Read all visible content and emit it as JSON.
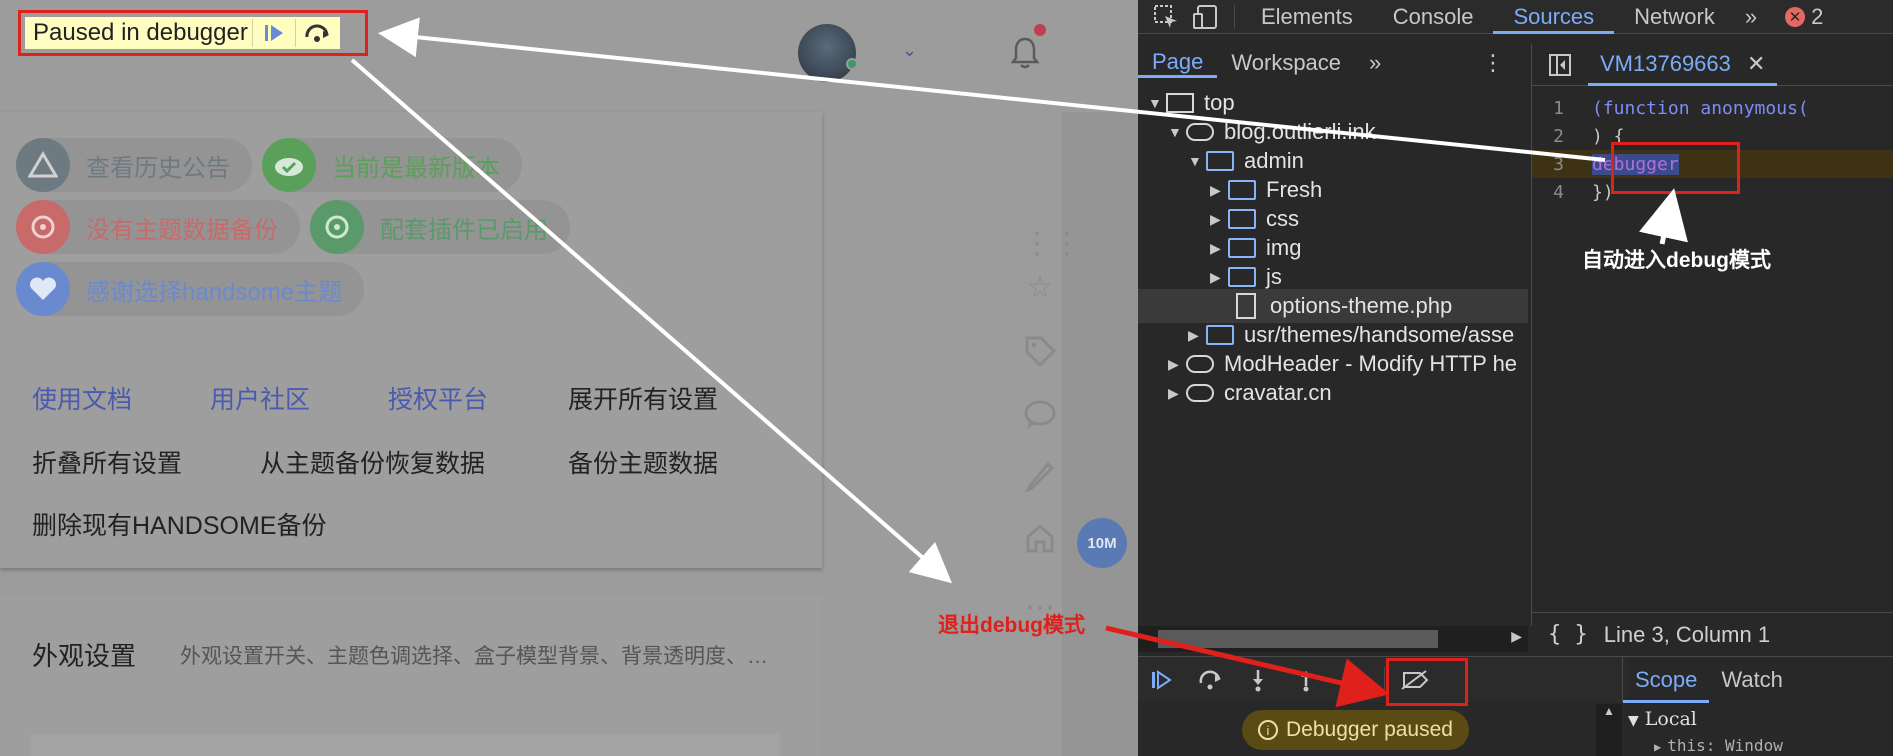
{
  "paused_overlay": {
    "label": "Paused in debugger"
  },
  "quick_links": [
    {
      "label": "查看历史公告",
      "color": "#6e7a82",
      "icon": "warning-triangle-icon"
    },
    {
      "label": "当前是最新版本",
      "color": "#5aa05a",
      "icon": "check-cloud-icon"
    },
    {
      "label": "没有主题数据备份",
      "color": "#c86a6a",
      "icon": "backup-icon"
    },
    {
      "label": "配套插件已启用",
      "color": "#5a9a6a",
      "icon": "plugin-icon"
    },
    {
      "label": "感谢选择handsome主题",
      "color": "#6a8ad0",
      "icon": "heart-icon"
    }
  ],
  "action_links": {
    "docs": "使用文档",
    "community": "用户社区",
    "license": "授权平台",
    "expand_all": "展开所有设置",
    "collapse_all": "折叠所有设置",
    "restore": "从主题备份恢复数据",
    "backup": "备份主题数据",
    "delete_backup": "删除现有HANDSOME备份"
  },
  "appearance": {
    "title": "外观设置",
    "desc": "外观设置开关、主题色调选择、盒子模型背景、背景透明度、…"
  },
  "timer_badge": "10M",
  "devtools": {
    "tabs": [
      "Elements",
      "Console",
      "Sources",
      "Network"
    ],
    "more": "»",
    "error_count": "2",
    "nav_tabs": [
      "Page",
      "Workspace"
    ],
    "nav_more": "»",
    "tree": {
      "top": "top",
      "domain": "blog.outlierli.ink",
      "admin": "admin",
      "fresh": "Fresh",
      "css": "css",
      "img": "img",
      "js": "js",
      "file": "options-theme.php",
      "usr": "usr/themes/handsome/asse",
      "modheader": "ModHeader - Modify HTTP he",
      "cravatar": "cravatar.cn"
    },
    "editor_tab": "VM13769663",
    "code": [
      {
        "n": "1",
        "text": "(function anonymous("
      },
      {
        "n": "2",
        "text": ") {"
      },
      {
        "n": "3",
        "text": "debugger"
      },
      {
        "n": "4",
        "text": "})"
      }
    ],
    "status": "Line 3, Column 1",
    "scope_tabs": [
      "Scope",
      "Watch"
    ],
    "paused_pill": "Debugger paused",
    "local": "Local",
    "this_line": "this: Window"
  },
  "annotations": {
    "auto_debug": "自动进入debug模式",
    "exit_debug": "退出debug模式",
    "arrow_color": "#ffffff",
    "red": "#e0201a"
  }
}
